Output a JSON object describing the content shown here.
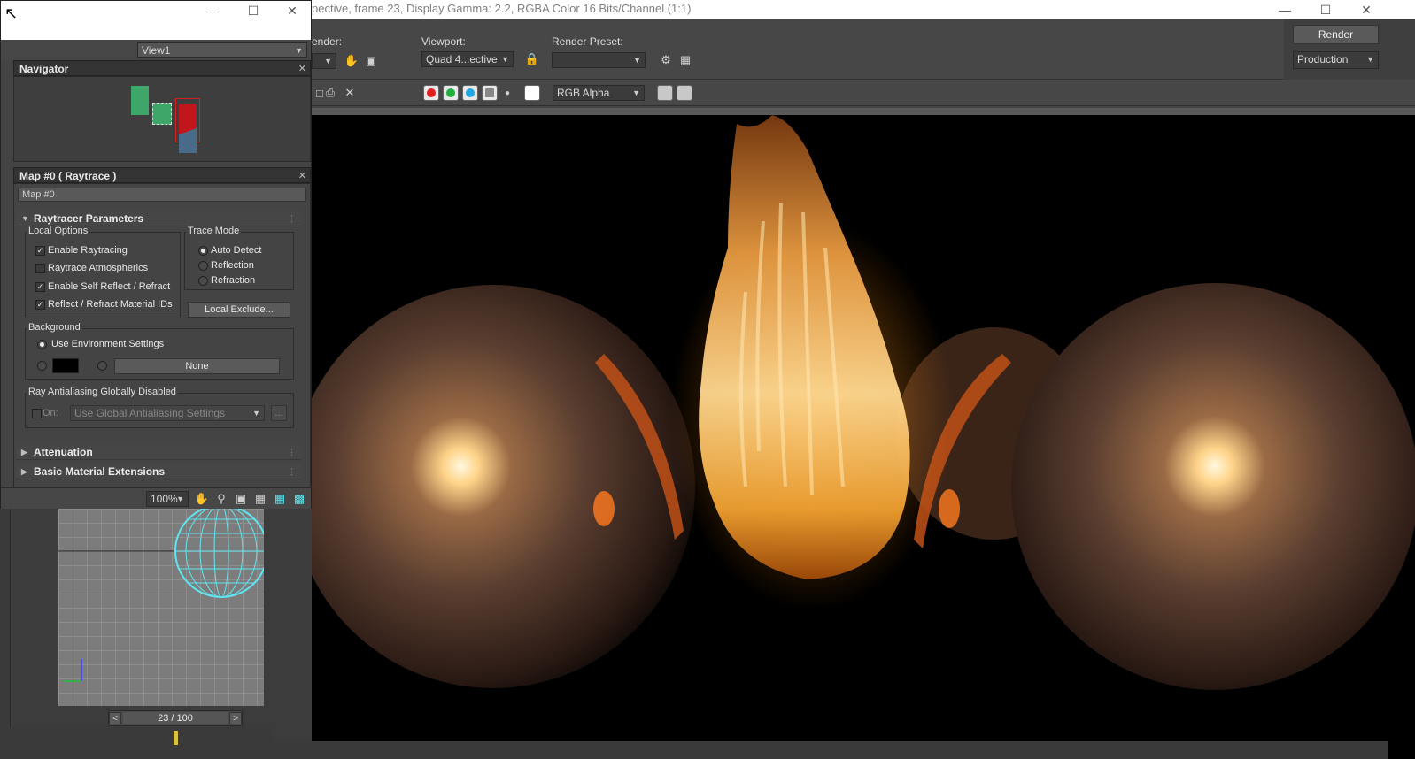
{
  "render_window": {
    "title": "pective, frame 23, Display Gamma: 2.2, RGBA Color 16 Bits/Channel (1:1)",
    "area_to_render_label": "ender:",
    "viewport_label": "Viewport:",
    "viewport_value": "Quad 4...ective",
    "render_preset_label": "Render Preset:",
    "render_preset_value": "",
    "render_button": "Render",
    "production_value": "Production",
    "channel_display_value": "RGB Alpha"
  },
  "material_editor": {
    "view_dropdown": "View1",
    "navigator": {
      "title": "Navigator"
    },
    "params_panel_title": "Map #0  ( Raytrace )",
    "map_name": "Map #0",
    "rollouts": {
      "raytracer_parameters": "Raytracer Parameters",
      "attenuation": "Attenuation",
      "basic_material_extensions": "Basic Material Extensions"
    },
    "local_options": {
      "label": "Local Options",
      "enable_raytracing": {
        "label": "Enable Raytracing",
        "checked": true
      },
      "raytrace_atmospherics": {
        "label": "Raytrace Atmospherics",
        "checked": false
      },
      "enable_self_reflect": {
        "label": "Enable Self Reflect / Refract",
        "checked": true
      },
      "reflect_refract_ids": {
        "label": "Reflect / Refract Material IDs",
        "checked": true
      }
    },
    "trace_mode": {
      "label": "Trace Mode",
      "options": [
        "Auto Detect",
        "Reflection",
        "Refraction"
      ],
      "selected": "Auto Detect"
    },
    "local_exclude_button": "Local Exclude...",
    "background": {
      "label": "Background",
      "use_env": "Use Environment Settings",
      "color_swatch": "#000000",
      "map_button": "None"
    },
    "antialiasing": {
      "label": "Ray Antialiasing Globally Disabled",
      "on_label": "On:",
      "dropdown": "Use Global Antialiasing Settings",
      "more_button": "..."
    },
    "zoom_value": "100%"
  },
  "timeline": {
    "frame_display": "23 / 100",
    "prev": "<",
    "next": ">"
  },
  "colors": {
    "panel_bg": "#444444",
    "accent_green": "#3fa66a",
    "accent_red": "#c0161c",
    "wire_cyan": "#5ee6f0"
  }
}
